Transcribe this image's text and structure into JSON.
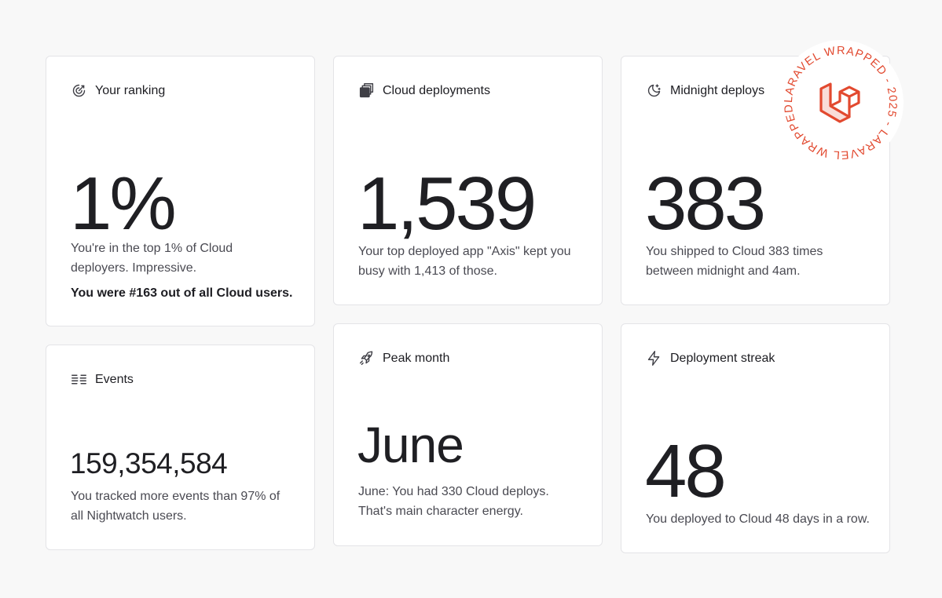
{
  "cards": {
    "ranking": {
      "title": "Your ranking",
      "value": "1%",
      "desc_line1": "You're in the top 1% of Cloud",
      "desc_line2": "deployers. Impressive.",
      "desc_strong": "You were #163 out of all Cloud users."
    },
    "deployments": {
      "title": "Cloud deployments",
      "value": "1,539",
      "desc_line1": "Your top deployed app \"Axis\" kept you",
      "desc_line2": "busy with 1,413 of those."
    },
    "midnight": {
      "title": "Midnight deploys",
      "value": "383",
      "desc_line1": "You shipped to Cloud 383 times",
      "desc_line2": "between midnight and 4am."
    },
    "events": {
      "title": "Events",
      "value": "159,354,584",
      "desc_line1": "You tracked more events than 97% of",
      "desc_line2": "all Nightwatch users."
    },
    "peak": {
      "title": "Peak month",
      "value": "June",
      "desc_line1": "June: You had 330 Cloud deploys.",
      "desc_line2": "That's main character energy."
    },
    "streak": {
      "title": "Deployment streak",
      "value": "48",
      "desc_line1": "You deployed to Cloud 48 days in a row."
    }
  },
  "badge": {
    "ring_text": "LARAVEL WRAPPED - 2025 - LARAVEL WRAPPED - 2025 -",
    "color": "#e2492f",
    "logo_icon": "laravel-logo-icon"
  },
  "icons": {
    "ranking": "target-icon",
    "deployments": "stacked-squares-icon",
    "midnight": "moon-stars-icon",
    "events": "events-waves-icon",
    "peak": "rocket-icon",
    "streak": "lightning-icon"
  },
  "colors": {
    "background": "#f8f8f8",
    "card": "#ffffff",
    "border": "#e4e4e7",
    "text": "#1d1d22",
    "muted": "#4a4a52"
  }
}
